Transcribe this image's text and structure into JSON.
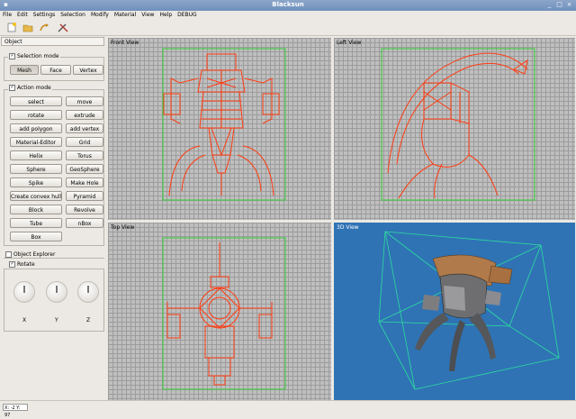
{
  "window": {
    "title": "Blacksun"
  },
  "menu": [
    "File",
    "Edit",
    "Settings",
    "Selection",
    "Modify",
    "Material",
    "View",
    "Help",
    "DEBUG"
  ],
  "panel": {
    "title": "Object",
    "selection_mode": {
      "label": "Selection mode",
      "buttons": [
        "Mesh",
        "Face",
        "Vertex"
      ],
      "active": "Mesh"
    },
    "action_mode": {
      "label": "Action mode",
      "buttons": [
        "select",
        "move",
        "rotate",
        "extrude",
        "add polygon",
        "add vertex",
        "Material-Editor",
        "Grid",
        "Helix",
        "Torus",
        "Sphere",
        "GeoSphere",
        "Spike",
        "Make Hole",
        "Create convex hull",
        "Pyramid",
        "Block",
        "Revolve",
        "Tube",
        "nBox",
        "Box"
      ]
    },
    "object_explorer": {
      "label": "Object Explorer"
    },
    "rotate": {
      "label": "Rotate",
      "axes": [
        "X",
        "Y",
        "Z"
      ]
    }
  },
  "views": {
    "front": "Front View",
    "left": "Left View",
    "top": "Top View",
    "perspective": "3D View"
  },
  "status": {
    "coords": "X: -2 Y: 97"
  },
  "colors": {
    "grid": "#bfbfbf",
    "wire": "#ff3b10",
    "bounds": "#33cc33",
    "viewport3d": "#2f73b5"
  }
}
